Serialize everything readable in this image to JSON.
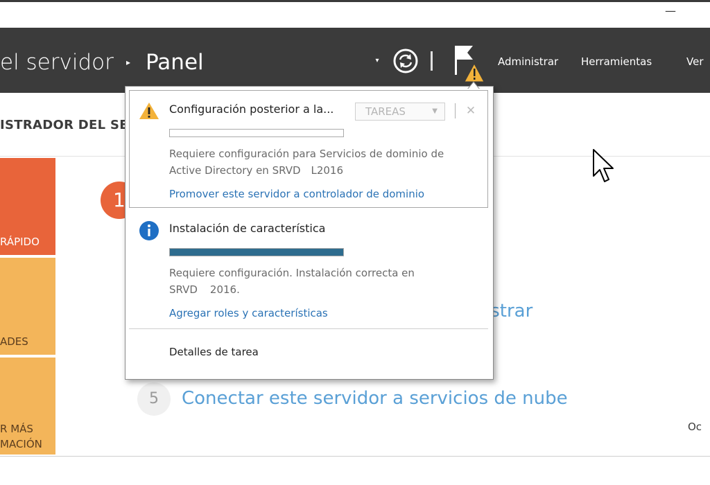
{
  "window": {
    "minimize_glyph": "—"
  },
  "header": {
    "title_left": "el servidor",
    "separator_glyph": "▸",
    "title_right": "Panel",
    "dropdown_glyph": "▾",
    "refresh_icon": "refresh-icon",
    "flag_icon": "notification-flag-icon",
    "menu": {
      "administrar": "Administrar",
      "herramientas": "Herramientas",
      "ver": "Ver"
    }
  },
  "subheader": {
    "title": "ISTRADOR DEL SE"
  },
  "tiles": [
    {
      "label": "RÁPIDO",
      "color": "#e8643a"
    },
    {
      "label": "ADES",
      "color": "#f3b55a"
    },
    {
      "label_line1": "R MÁS",
      "label_line2": "MACIÓN",
      "color": "#f3b55a"
    }
  ],
  "main": {
    "step1_number": "1",
    "partial_text": "istrar",
    "step5_number": "5",
    "step5_link": "Conectar este servidor a servicios de nube",
    "right_partial": "Oc"
  },
  "notifications": {
    "post_config": {
      "icon": "warning-icon",
      "title": "Configuración posterior a la...",
      "tasks_label": "TAREAS",
      "tasks_arrow": "▼",
      "close_glyph": "✕",
      "progress": 0.0,
      "desc_line1": "Requiere configuración para Servicios de dominio de",
      "desc_line2": "Active Directory en SRVD     L2016",
      "link": "Promover este servidor a controlador de dominio"
    },
    "feature_install": {
      "icon": "info-icon",
      "title": "Instalación de característica",
      "progress": 1.0,
      "desc_line1": "Requiere configuración. Instalación correcta en",
      "desc_line2": "SRVD      2016.",
      "link": "Agregar roles y características"
    },
    "task_details": "Detalles de tarea"
  },
  "colors": {
    "header_bg": "#3b3b3b",
    "accent_orange": "#e8643a",
    "tile_yellow": "#f3b55a",
    "link_blue": "#2a72b5",
    "progress_blue": "#2e6c8e"
  }
}
